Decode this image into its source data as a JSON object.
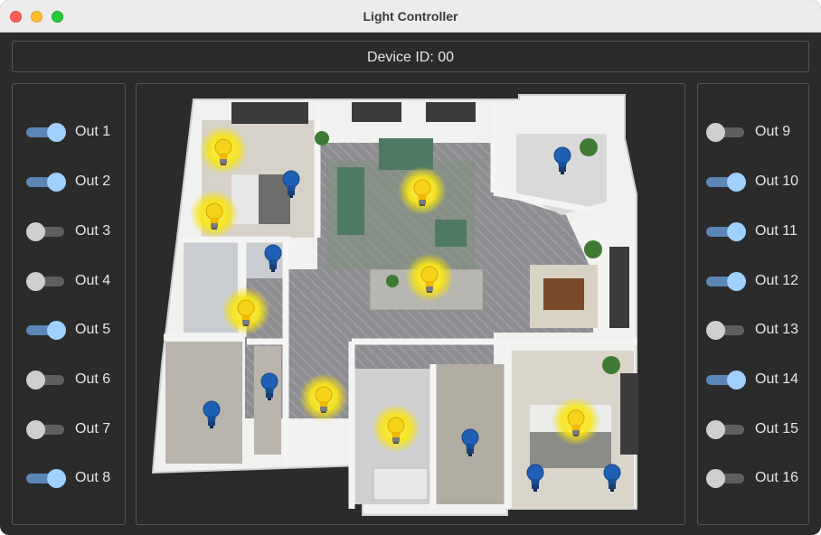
{
  "window": {
    "title": "Light Controller"
  },
  "device": {
    "label": "Device ID: 00"
  },
  "outputs_left": [
    {
      "label": "Out 1",
      "on": true
    },
    {
      "label": "Out 2",
      "on": true
    },
    {
      "label": "Out 3",
      "on": false
    },
    {
      "label": "Out 4",
      "on": false
    },
    {
      "label": "Out 5",
      "on": true
    },
    {
      "label": "Out 6",
      "on": false
    },
    {
      "label": "Out 7",
      "on": false
    },
    {
      "label": "Out 8",
      "on": true
    }
  ],
  "outputs_right": [
    {
      "label": "Out 9",
      "on": false
    },
    {
      "label": "Out 10",
      "on": true
    },
    {
      "label": "Out 11",
      "on": true
    },
    {
      "label": "Out 12",
      "on": true
    },
    {
      "label": "Out 13",
      "on": false
    },
    {
      "label": "Out 14",
      "on": true
    },
    {
      "label": "Out 15",
      "on": false
    },
    {
      "label": "Out 16",
      "on": false
    }
  ],
  "colors": {
    "bulb_on": "#f6d21a",
    "bulb_off": "#1f5fb5",
    "switch_on_track": "#5b86b6",
    "switch_on_knob": "#9fd0ff"
  }
}
